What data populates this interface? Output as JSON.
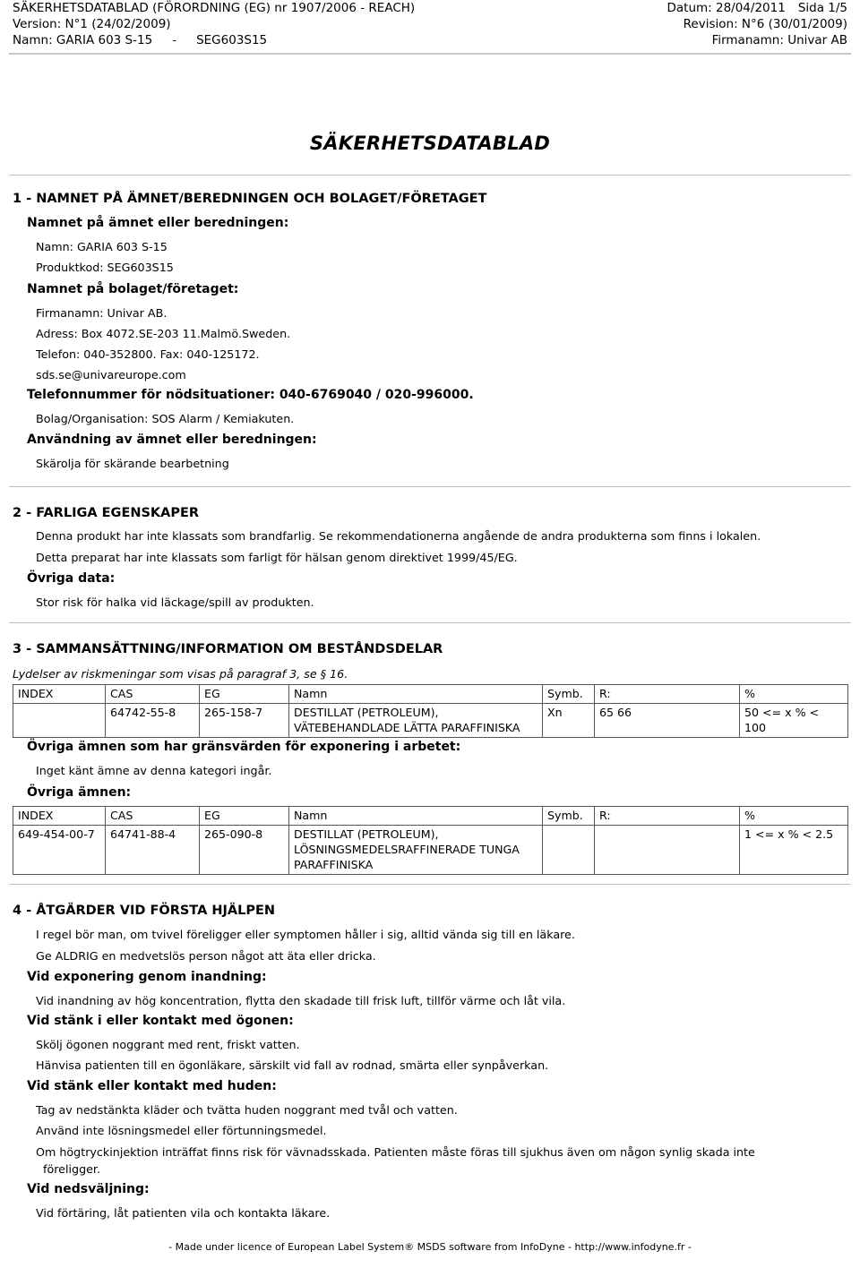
{
  "header": {
    "left_line1": "SÄKERHETSDATABLAD (FÖRORDNING (EG) nr 1907/2006 - REACH)",
    "left_line2": "Version: N°1 (24/02/2009)",
    "left_line3_label": "Namn: GARIA 603 S-15",
    "left_line3_dash": "-",
    "left_line3_code": "SEG603S15",
    "right_line1_date": "Datum: 28/04/2011",
    "right_line1_page": "Sida 1/5",
    "right_line2": "Revision: N°6 (30/01/2009)",
    "right_line3": "Firmanamn: Univar AB"
  },
  "title": "SÄKERHETSDATABLAD",
  "section1": {
    "heading": "1 - NAMNET PÅ ÄMNET/BEREDNINGEN OCH BOLAGET/FÖRETAGET",
    "sub1": "Namnet på ämnet eller beredningen:",
    "name": "Namn: GARIA 603 S-15",
    "product_code": "Produktkod: SEG603S15",
    "sub2": "Namnet på bolaget/företaget:",
    "company": "Firmanamn: Univar AB.",
    "address": "Adress: Box 4072.SE-203 11.Malmö.Sweden.",
    "phone_fax": "Telefon: 040-352800.  Fax: 040-125172.",
    "email": "sds.se@univareurope.com",
    "emergency": "Telefonnummer för nödsituationer: 040-6769040 / 020-996000.",
    "emergency_org": "Bolag/Organisation: SOS Alarm / Kemiakuten.",
    "sub3": "Användning av ämnet eller beredningen:",
    "use": "Skärolja för skärande bearbetning"
  },
  "section2": {
    "heading": "2 - FARLIGA EGENSKAPER",
    "line1": "Denna produkt har inte klassats som brandfarlig. Se rekommendationerna angående de andra produkterna som finns i lokalen.",
    "line2": "Detta preparat har inte klassats som farligt för hälsan genom direktivet 1999/45/EG.",
    "sub1": "Övriga data:",
    "line3": "Stor risk för halka vid läckage/spill av produkten."
  },
  "section3": {
    "heading": "3 - SAMMANSÄTTNING/INFORMATION OM BESTÅNDSDELAR",
    "note": "Lydelser av riskmeningar som visas på paragraf 3, se § 16.",
    "table1": {
      "columns": [
        "INDEX",
        "CAS",
        "EG",
        "Namn",
        "Symb.",
        "R:",
        "%"
      ],
      "rows": [
        {
          "index": "",
          "cas": "64742-55-8",
          "eg": "265-158-7",
          "namn": [
            "DESTILLAT (PETROLEUM),",
            "VÄTEBEHANDLADE LÄTTA PARAFFINISKA"
          ],
          "symb": "Xn",
          "r": "65  66",
          "pct": "50 <= x % < 100"
        }
      ]
    },
    "sub_limits": "Övriga ämnen som har gränsvärden för exponering i arbetet:",
    "limits_text": "Inget känt ämne av denna kategori ingår.",
    "sub_other": "Övriga ämnen:",
    "table2": {
      "columns": [
        "INDEX",
        "CAS",
        "EG",
        "Namn",
        "Symb.",
        "R:",
        "%"
      ],
      "rows": [
        {
          "index": "649-454-00-7",
          "cas": "64741-88-4",
          "eg": "265-090-8",
          "namn": [
            "DESTILLAT (PETROLEUM),",
            "LÖSNINGSMEDELSRAFFINERADE TUNGA",
            "PARAFFINISKA"
          ],
          "symb": "",
          "r": "",
          "pct": "1 <= x % < 2.5"
        }
      ]
    }
  },
  "section4": {
    "heading": "4 - ÅTGÄRDER VID FÖRSTA HJÄLPEN",
    "line1": "I regel bör man, om tvivel föreligger eller symptomen håller i sig, alltid vända sig till en läkare.",
    "line2": "Ge ALDRIG en medvetslös person något att äta eller dricka.",
    "sub_inhalation": "Vid exponering genom inandning:",
    "inhalation_text": "Vid inandning av hög koncentration, flytta den skadade till frisk luft, tillför värme och låt vila.",
    "sub_eyes": "Vid stänk i eller kontakt med ögonen:",
    "eyes_text1": "Skölj ögonen noggrant med rent, friskt vatten.",
    "eyes_text2": "Hänvisa patienten till en ögonläkare, särskilt vid fall av rodnad, smärta eller synpåverkan.",
    "sub_skin": "Vid stänk eller kontakt med huden:",
    "skin_text1": "Tag av nedstänkta kläder och tvätta huden noggrant med tvål och vatten.",
    "skin_text2": "Använd inte lösningsmedel eller förtunningsmedel.",
    "skin_text3": "Om högtryckinjektion inträffat finns risk för vävnadsskada. Patienten måste föras till sjukhus även om någon synlig skada inte",
    "skin_text3_cont": "föreligger.",
    "sub_swallow": "Vid nedsväljning:",
    "swallow_text": "Vid förtäring, låt patienten vila och kontakta läkare."
  },
  "footer": {
    "text": "- Made under licence of European Label System® MSDS software from InfoDyne  - http://www.infodyne.fr -"
  }
}
